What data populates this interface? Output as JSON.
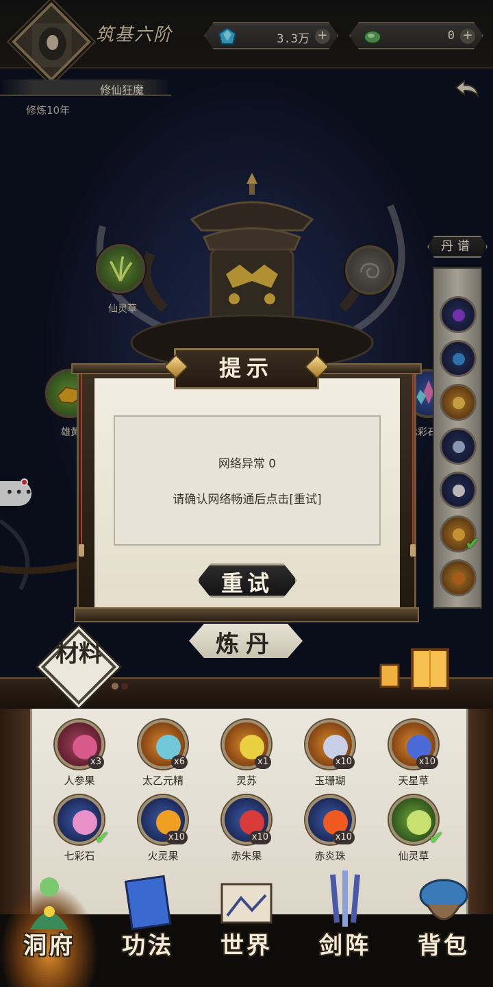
{
  "header": {
    "realm": "筑基六阶",
    "resources": [
      {
        "icon": "spirit-stone-icon",
        "value": "3.3万"
      },
      {
        "icon": "jade-icon",
        "value": "0"
      }
    ],
    "player_name": "修仙狂魔",
    "cultivation": "修炼10年"
  },
  "furnace": {
    "slots": [
      {
        "label": "仙灵草"
      },
      {
        "label": ""
      },
      {
        "label": "雄黄"
      },
      {
        "label": "七彩石"
      }
    ]
  },
  "recipe": {
    "title": "丹谱",
    "items": [
      {
        "color": "#8a3ad0"
      },
      {
        "color": "#3a8ad0"
      },
      {
        "color": "#d8a030"
      },
      {
        "color": "#a8b8d8"
      },
      {
        "color": "#e0e0e0"
      },
      {
        "color": "#d89a30",
        "checked": true
      },
      {
        "color": "#c87020"
      }
    ]
  },
  "dialog": {
    "title": "提示",
    "message_title": "网络异常 0",
    "message_body": "请确认网络畅通后点击[重试]",
    "retry_label": "重试"
  },
  "alchemy": {
    "refine_label": "炼丹",
    "materials_tab": "材料"
  },
  "materials": [
    {
      "name": "人参果",
      "count": "x3",
      "ring": "red"
    },
    {
      "name": "太乙元精",
      "count": "x6",
      "ring": "orange"
    },
    {
      "name": "灵苏",
      "count": "x1",
      "ring": "orange"
    },
    {
      "name": "玉珊瑚",
      "count": "x10",
      "ring": "orange"
    },
    {
      "name": "天星草",
      "count": "x10",
      "ring": "orange"
    },
    {
      "name": "七彩石",
      "count": "",
      "ring": "blue",
      "checked": true
    },
    {
      "name": "火灵果",
      "count": "x10",
      "ring": "blue"
    },
    {
      "name": "赤朱果",
      "count": "x10",
      "ring": "blue"
    },
    {
      "name": "赤炎珠",
      "count": "x10",
      "ring": "blue"
    },
    {
      "name": "仙灵草",
      "count": "",
      "ring": "green",
      "checked": true
    }
  ],
  "nav": {
    "items": [
      {
        "label": "洞府",
        "active": true
      },
      {
        "label": "功法"
      },
      {
        "label": "世界"
      },
      {
        "label": "剑阵"
      },
      {
        "label": "背包"
      }
    ]
  },
  "colors": {
    "accent_gold": "#c8a050",
    "paper": "#efe9dc",
    "check_green": "#5fd54a"
  }
}
